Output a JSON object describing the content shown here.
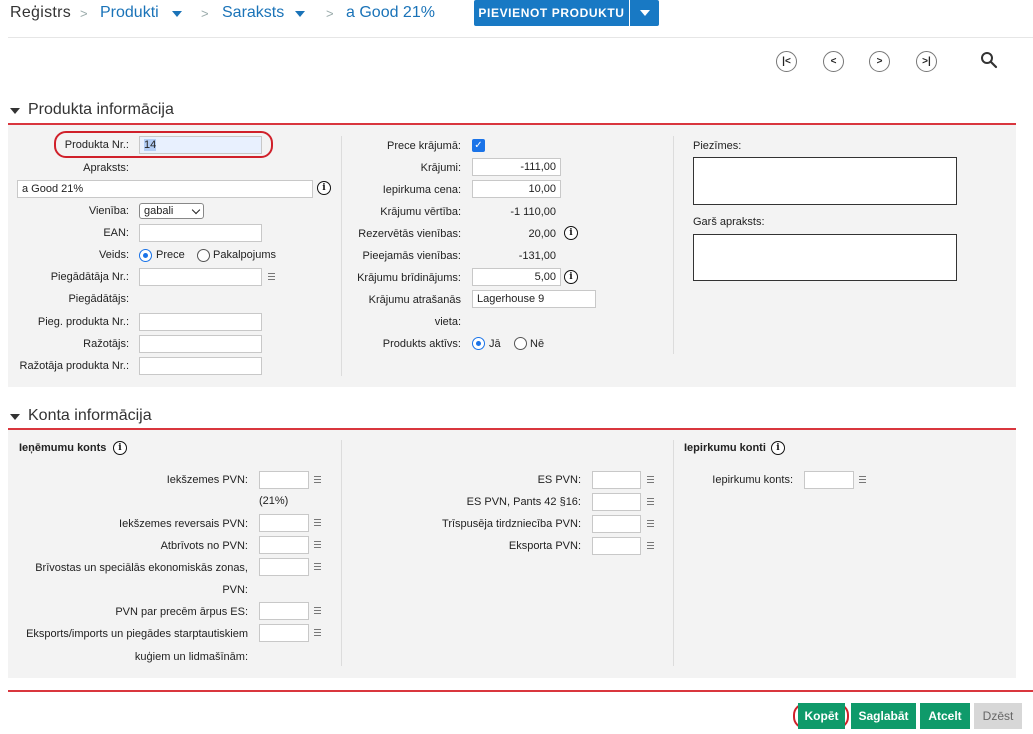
{
  "breadcrumb": {
    "root": "Reģistrs",
    "sep": ">",
    "items": [
      "Produkti",
      "Saraksts",
      "a Good 21%"
    ],
    "add_button": "PIEVIENOT PRODUKTU"
  },
  "nav": {
    "first": "|<",
    "prev": "<",
    "next": ">",
    "last": ">|"
  },
  "product_section": {
    "title": "Produkta informācija",
    "product_nr_label": "Produkta Nr.:",
    "product_nr_value": "14",
    "description_label": "Apraksts:",
    "description_value": "a Good 21%",
    "unit_label": "Vienība:",
    "unit_value": "gabali",
    "ean_label": "EAN:",
    "type_label": "Veids:",
    "type_options": [
      "Prece",
      "Pakalpojums"
    ],
    "supplier_nr_label": "Piegādātāja Nr.:",
    "supplier_label": "Piegādātājs:",
    "supplier_product_nr_label": "Pieg. produkta Nr.:",
    "manufacturer_label": "Ražotājs:",
    "manufacturer_product_nr_label": "Ražotāja produkta Nr.:",
    "in_stock_label": "Prece krājumā:",
    "stock_label": "Krājumi:",
    "stock_value": "-111,00",
    "purchase_price_label": "Iepirkuma cena:",
    "purchase_price_value": "10,00",
    "stock_value_label": "Krājumu vērtība:",
    "stock_value_value": "-1 110,00",
    "reserved_label": "Rezervētās vienības:",
    "reserved_value": "20,00",
    "available_label": "Pieejamās vienības:",
    "available_value": "-131,00",
    "stock_warning_label": "Krājumu brīdinājums:",
    "stock_warning_value": "5,00",
    "stock_location_label": "Krājumu atrašanās",
    "stock_location_label2": "vieta:",
    "stock_location_value": "Lagerhouse 9",
    "active_label": "Produkts aktīvs:",
    "active_options": [
      "Jā",
      "Nē"
    ],
    "notes_label": "Piezīmes:",
    "long_desc_label": "Garš apraksts:"
  },
  "account_section": {
    "title": "Konta informācija",
    "income_title": "Ieņēmumu konts",
    "domestic_vat_label": "Iekšzemes PVN:",
    "domestic_vat_note": "(21%)",
    "domestic_reverse_label": "Iekšzemes reversais PVN:",
    "vat_exempt_label": "Atbrīvots no PVN:",
    "freeport_label": "Brīvostas un speciālās ekonomiskās zonas,",
    "freeport_label2": "PVN:",
    "outside_eu_label": "PVN par precēm ārpus ES:",
    "export_import_label": "Eksports/imports un piegādes starptautiskiem",
    "export_import_label2": "kuģiem un lidmašīnām:",
    "es_vat_label": "ES PVN:",
    "es_vat_42_label": "ES PVN, Pants 42 §16:",
    "triangular_label": "Trīspusēja tirdzniecība PVN:",
    "export_vat_label": "Eksporta PVN:",
    "purchase_title": "Iepirkumu konti",
    "purchase_account_label": "Iepirkumu konts:"
  },
  "actions": {
    "copy": "Kopēt",
    "save": "Saglabāt",
    "cancel": "Atcelt",
    "delete": "Dzēst"
  }
}
